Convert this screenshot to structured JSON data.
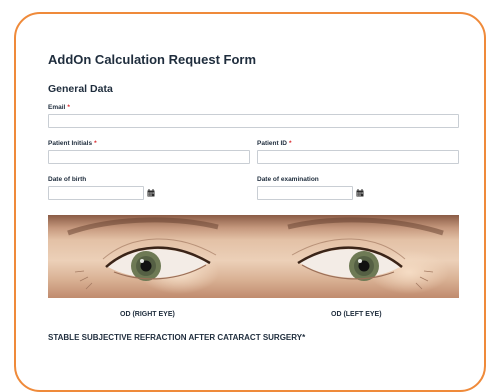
{
  "form": {
    "title": "AddOn Calculation Request Form",
    "section_title": "General Data",
    "required_marker": "*"
  },
  "fields": {
    "email": {
      "label": "Email",
      "value": "",
      "required": true
    },
    "patient_initials": {
      "label": "Patient Initials",
      "value": "",
      "required": true
    },
    "patient_id": {
      "label": "Patient ID",
      "value": "",
      "required": true
    },
    "date_of_birth": {
      "label": "Date of birth",
      "value": "",
      "icon": "calendar-icon"
    },
    "date_of_examination": {
      "label": "Date of examination",
      "value": "",
      "icon": "calendar-icon"
    }
  },
  "eyes": {
    "right_label": "OD (RIGHT EYE)",
    "left_label": "OD (LEFT EYE)"
  },
  "refraction": {
    "heading": "STABLE SUBJECTIVE REFRACTION AFTER CATARACT SURGERY*"
  },
  "colors": {
    "accent_border": "#ef8a3a",
    "required": "#d9252a",
    "text": "#1f2d3d",
    "field_border": "#c9ced4"
  }
}
